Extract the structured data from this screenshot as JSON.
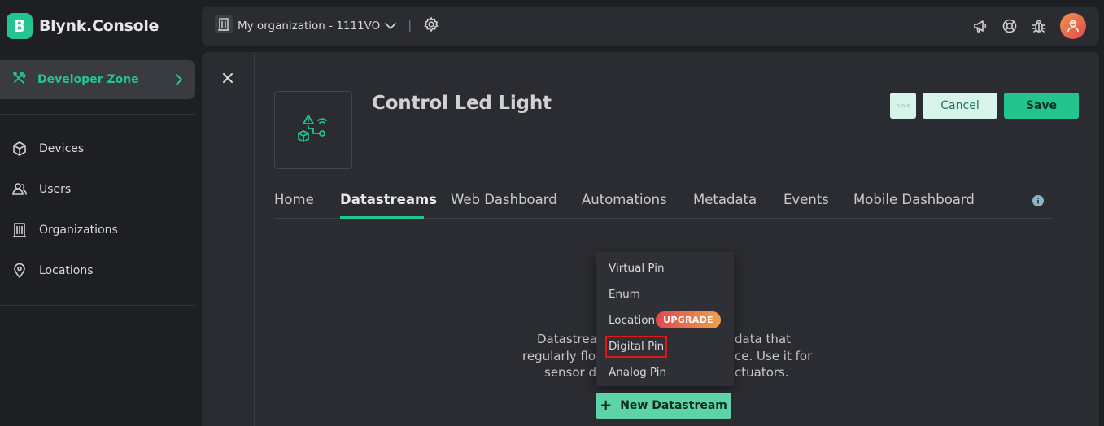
{
  "brand": {
    "logo_letter": "B",
    "name": "Blynk.Console"
  },
  "sidebar": {
    "developer_zone": "Developer Zone",
    "items": [
      {
        "label": "Devices",
        "icon": "cube-icon"
      },
      {
        "label": "Users",
        "icon": "users-icon"
      },
      {
        "label": "Organizations",
        "icon": "building-icon"
      },
      {
        "label": "Locations",
        "icon": "location-pin-icon"
      }
    ]
  },
  "topbar": {
    "org_label": "My organization - 1111VO",
    "separator": "|",
    "icons": [
      "megaphone-icon",
      "lifebuoy-icon",
      "bug-icon",
      "avatar"
    ]
  },
  "template": {
    "title": "Control Led Light",
    "more_label": "◦◦◦",
    "cancel_label": "Cancel",
    "save_label": "Save"
  },
  "tabs": [
    "Home",
    "Datastreams",
    "Web Dashboard",
    "Automations",
    "Metadata",
    "Events",
    "Mobile Dashboard"
  ],
  "active_tab": "Datastreams",
  "empty_state": {
    "line1_start": "Datastrea",
    "line1_end": "data that",
    "line2_start": "regularly flo",
    "line2_end": "ce. Use it for",
    "line3_start": "sensor d",
    "line3_end": "ctuators."
  },
  "menu": {
    "items": [
      "Virtual Pin",
      "Enum",
      "Location",
      "Digital Pin",
      "Analog Pin"
    ],
    "upgrade_badge": "UPGRADE",
    "highlighted": "Digital Pin"
  },
  "new_datastream": {
    "plus": "+",
    "label": "New Datastream"
  },
  "colors": {
    "accent": "#23c48e",
    "sidebar_bg": "#1e1f22",
    "panel_bg": "#2b2c31",
    "highlight": "#e0161c"
  }
}
